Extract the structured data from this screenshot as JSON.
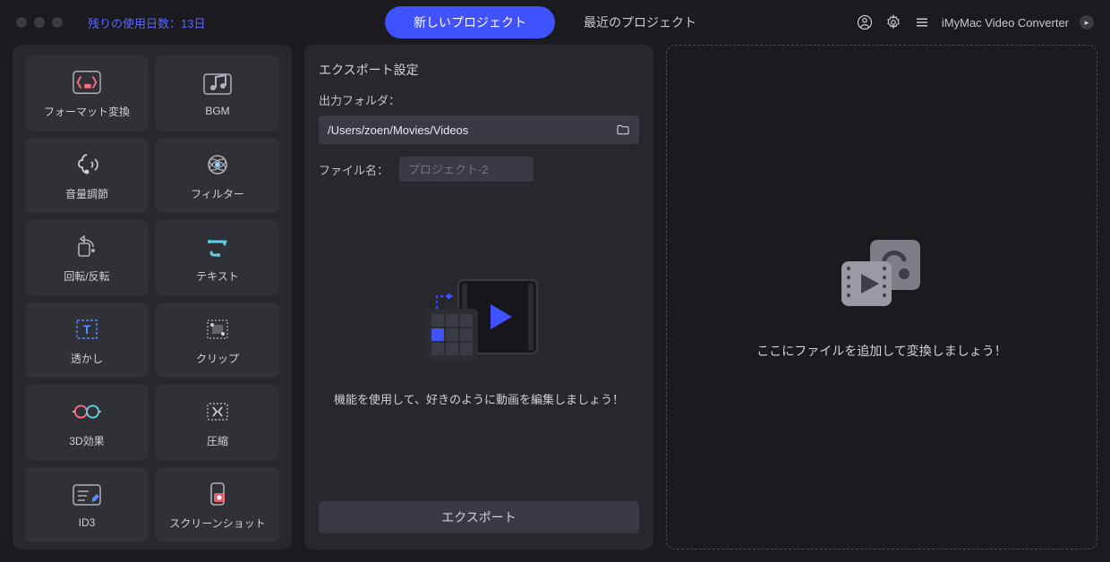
{
  "titlebar": {
    "trial_label": "残りの使用日数：13日",
    "tabs": {
      "new": "新しいプロジェクト",
      "recent": "最近のプロジェクト"
    },
    "app_name": "iMyMac Video Converter"
  },
  "tools": [
    {
      "id": "format",
      "label": "フォーマット変換"
    },
    {
      "id": "bgm",
      "label": "BGM"
    },
    {
      "id": "volume",
      "label": "音量調節"
    },
    {
      "id": "filter",
      "label": "フィルター"
    },
    {
      "id": "rotate",
      "label": "回転/反転"
    },
    {
      "id": "text",
      "label": "テキスト"
    },
    {
      "id": "watermark",
      "label": "透かし"
    },
    {
      "id": "clip",
      "label": "クリップ"
    },
    {
      "id": "threed",
      "label": "3D効果"
    },
    {
      "id": "compress",
      "label": "圧縮"
    },
    {
      "id": "id3",
      "label": "ID3"
    },
    {
      "id": "screenshot",
      "label": "スクリーンショット"
    }
  ],
  "export": {
    "section_title": "エクスポート設定",
    "folder_label": "出力フォルダ：",
    "folder_path": "/Users/zoen/Movies/Videos",
    "filename_label": "ファイル名：",
    "filename_placeholder": "プロジェクト-2",
    "hint": "機能を使用して、好きのように動画を編集しましょう！",
    "button": "エクスポート"
  },
  "dropzone": {
    "text": "ここにファイルを追加して変換しましょう！"
  }
}
